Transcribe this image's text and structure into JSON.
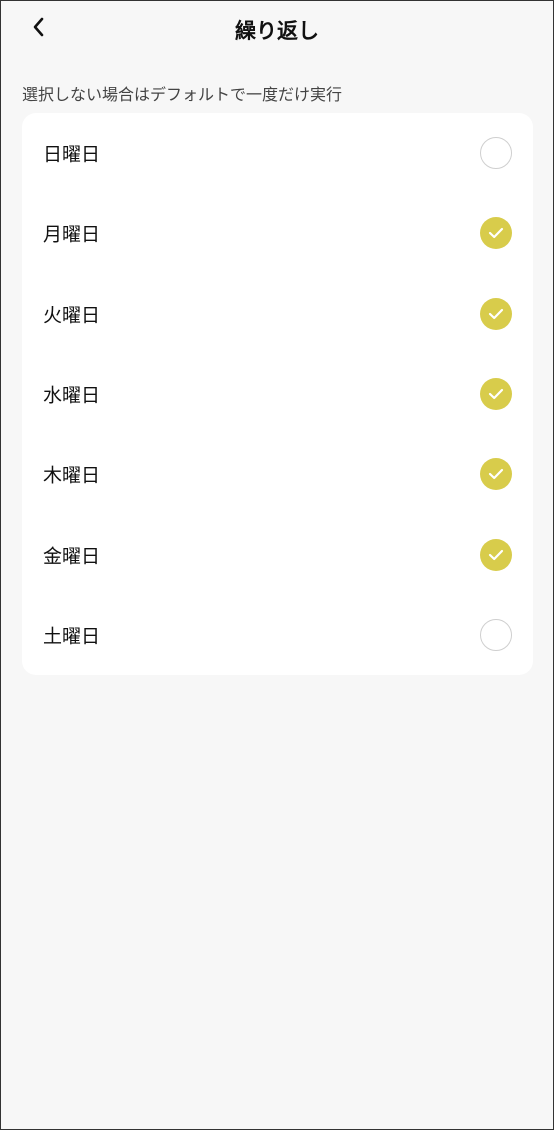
{
  "header": {
    "title": "繰り返し",
    "back_icon": "chevron-left-icon"
  },
  "hint": "選択しない場合はデフォルトで一度だけ実行",
  "accent_color": "#d8cc4b",
  "days": [
    {
      "label": "日曜日",
      "checked": false
    },
    {
      "label": "月曜日",
      "checked": true
    },
    {
      "label": "火曜日",
      "checked": true
    },
    {
      "label": "水曜日",
      "checked": true
    },
    {
      "label": "木曜日",
      "checked": true
    },
    {
      "label": "金曜日",
      "checked": true
    },
    {
      "label": "土曜日",
      "checked": false
    }
  ]
}
